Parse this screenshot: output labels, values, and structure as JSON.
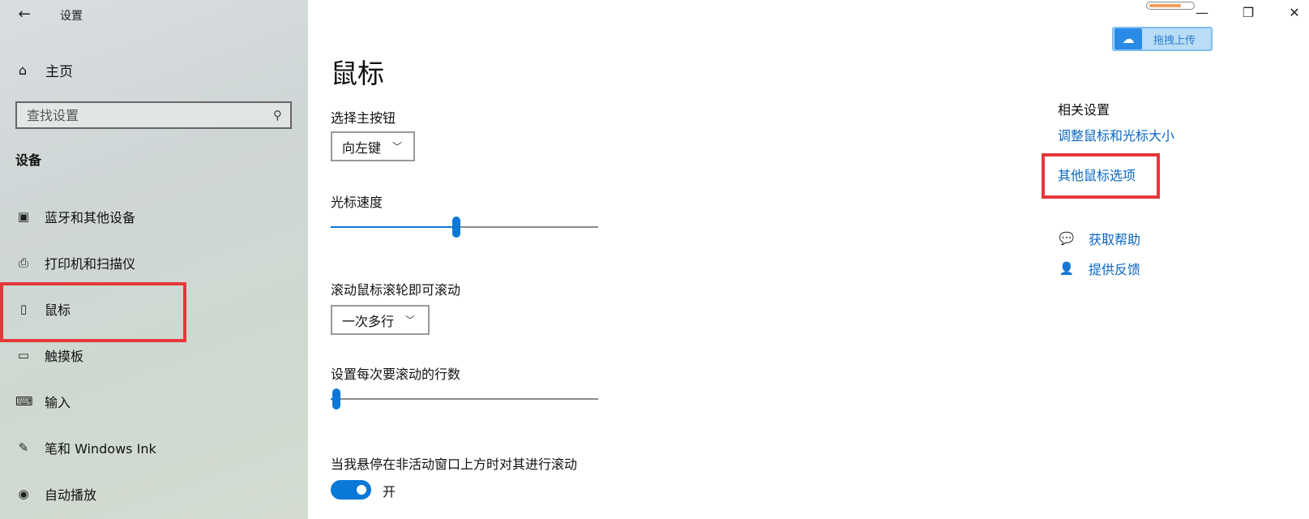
{
  "window": {
    "back_icon": "back-arrow-icon",
    "title": "设置",
    "minimize": "—",
    "restore": "❐",
    "close": "✕"
  },
  "overlay": {
    "upload_label": "拖拽上传",
    "progress": 0.75
  },
  "sidebar": {
    "home_label": "主页",
    "search_placeholder": "查找设置",
    "section_title": "设备",
    "items": [
      {
        "label": "蓝牙和其他设备",
        "icon": "bluetooth-devices-icon"
      },
      {
        "label": "打印机和扫描仪",
        "icon": "printer-icon"
      },
      {
        "label": "鼠标",
        "icon": "mouse-icon",
        "selected": true
      },
      {
        "label": "触摸板",
        "icon": "touchpad-icon"
      },
      {
        "label": "输入",
        "icon": "keyboard-icon"
      },
      {
        "label": "笔和 Windows Ink",
        "icon": "pen-icon"
      },
      {
        "label": "自动播放",
        "icon": "autoplay-icon"
      }
    ]
  },
  "main": {
    "title": "鼠标",
    "primary_button": {
      "label": "选择主按钮",
      "value": "向左键"
    },
    "cursor_speed": {
      "label": "光标速度",
      "value": 0.47
    },
    "scroll_wheel": {
      "label": "滚动鼠标滚轮即可滚动",
      "value": "一次多行"
    },
    "lines_per_scroll": {
      "label": "设置每次要滚动的行数",
      "value": 0.02
    },
    "inactive_scroll": {
      "label": "当我悬停在非活动窗口上方时对其进行滚动",
      "state": "开",
      "on": true
    }
  },
  "related": {
    "title": "相关设置",
    "links": [
      "调整鼠标和光标大小",
      "其他鼠标选项"
    ],
    "help": [
      {
        "label": "获取帮助",
        "icon": "help-chat-icon"
      },
      {
        "label": "提供反馈",
        "icon": "feedback-icon"
      }
    ]
  },
  "colors": {
    "accent": "#0a78d7",
    "link": "#0a66c2",
    "highlight": "#e5383b"
  }
}
